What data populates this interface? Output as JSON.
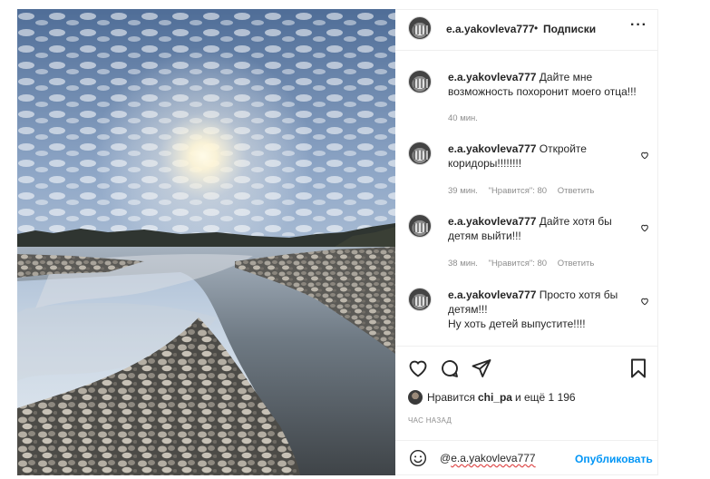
{
  "post": {
    "photo_icon": "river-landscape-photo"
  },
  "header": {
    "username": "e.a.yakovleva777",
    "separator": "•",
    "follow_label": "Подписки",
    "more_label": "···"
  },
  "comments": [
    {
      "user": "e.a.yakovleva777",
      "lines": [
        "Дайте мне",
        "возможность похоронит моего отца!!!"
      ],
      "time": "40 мин.",
      "likes": "",
      "reply": ""
    },
    {
      "user": "e.a.yakovleva777",
      "lines": [
        "Откройте",
        "коридоры!!!!!!!!"
      ],
      "time": "39 мин.",
      "likes": "\"Нравится\": 80",
      "reply": "Ответить"
    },
    {
      "user": "e.a.yakovleva777",
      "lines": [
        "Дайте хотя бы",
        "детям выйти!!!"
      ],
      "time": "38 мин.",
      "likes": "\"Нравится\": 80",
      "reply": "Ответить"
    },
    {
      "user": "e.a.yakovleva777",
      "lines": [
        "Просто хотя бы",
        "детям!!!",
        "Ну хоть детей выпустите!!!!"
      ],
      "time": "",
      "likes": "",
      "reply": ""
    }
  ],
  "likes_bar": {
    "prefix": "Нравится",
    "user": "chi_pa",
    "suffix": "и ещё 1 196"
  },
  "timestamp": "ЧАС НАЗАД",
  "add_comment": {
    "prefix": "@",
    "value": "e.a.yakovleva777",
    "post_label": "Опубликовать"
  },
  "colors": {
    "accent": "#0095f6",
    "muted": "#8e8e8e",
    "text": "#262626"
  },
  "icons": [
    "heart-icon",
    "comment-icon",
    "share-icon",
    "bookmark-icon",
    "emoji-icon",
    "more-icon"
  ]
}
